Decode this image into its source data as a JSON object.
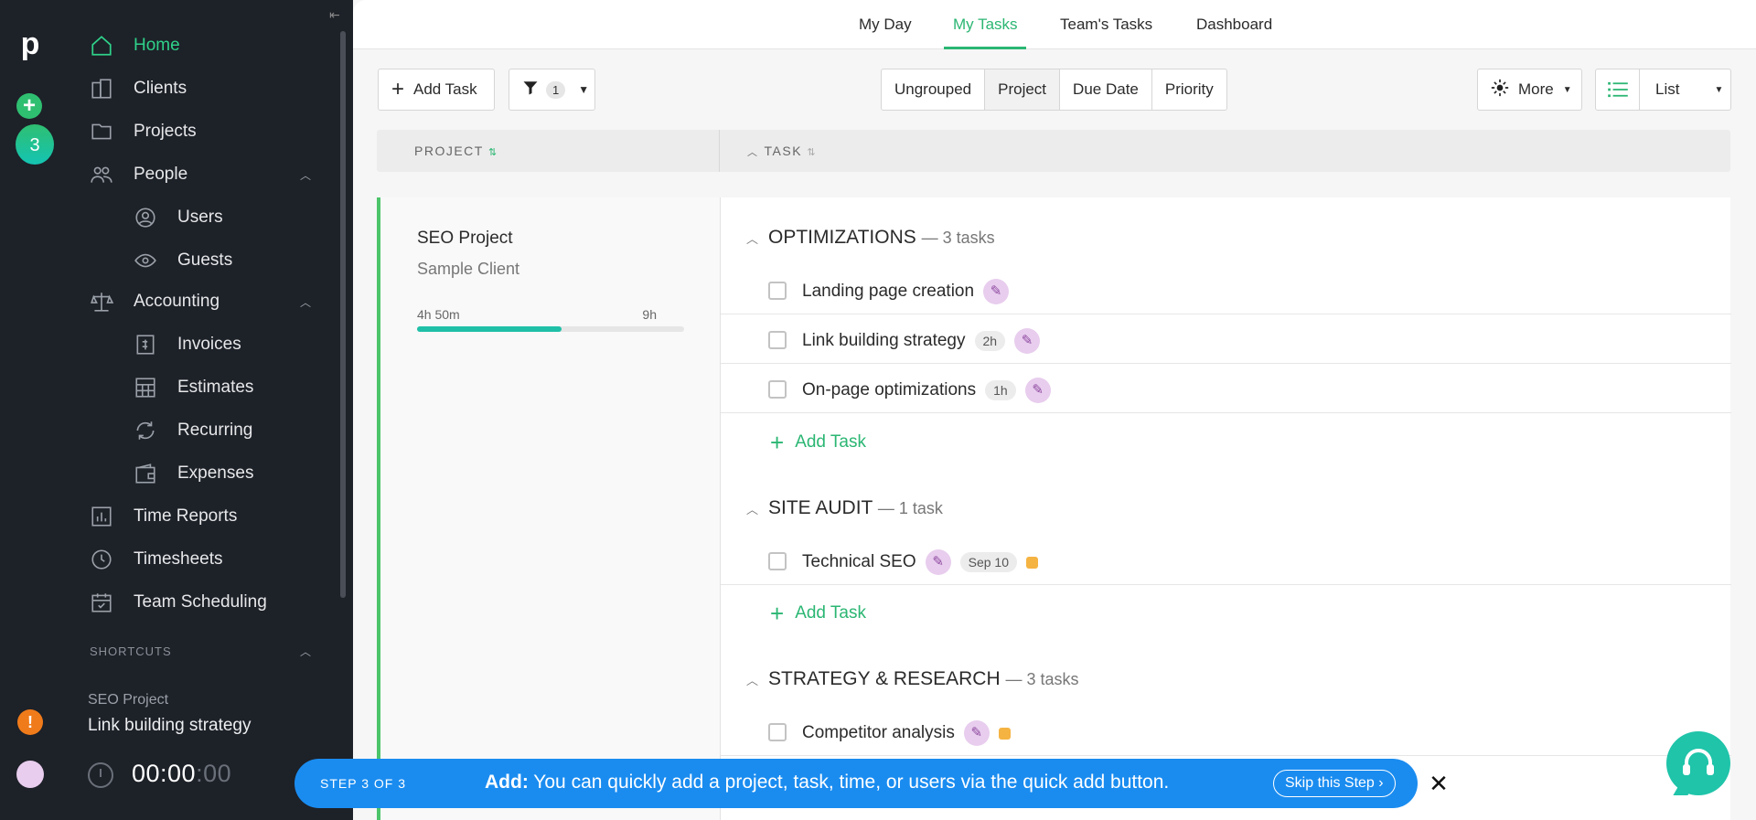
{
  "sidebar": {
    "items": [
      {
        "label": "Home",
        "icon": "home-icon",
        "active": true
      },
      {
        "label": "Clients",
        "icon": "clients-icon"
      },
      {
        "label": "Projects",
        "icon": "folder-icon"
      },
      {
        "label": "People",
        "icon": "people-icon"
      },
      {
        "label": "Users",
        "icon": "user-icon"
      },
      {
        "label": "Guests",
        "icon": "eye-icon"
      },
      {
        "label": "Accounting",
        "icon": "scale-icon"
      },
      {
        "label": "Invoices",
        "icon": "invoice-icon"
      },
      {
        "label": "Estimates",
        "icon": "estimates-icon"
      },
      {
        "label": "Recurring",
        "icon": "recurring-icon"
      },
      {
        "label": "Expenses",
        "icon": "wallet-icon"
      },
      {
        "label": "Time Reports",
        "icon": "chart-icon"
      },
      {
        "label": "Timesheets",
        "icon": "clock-icon"
      },
      {
        "label": "Team Scheduling",
        "icon": "calendar-icon"
      }
    ],
    "shortcuts_title": "SHORTCUTS",
    "shortcut": {
      "project": "SEO Project",
      "task": "Link building strategy"
    },
    "timer": {
      "main": "00:00",
      "sep": ":",
      "sec": "00"
    }
  },
  "rail": {
    "logo": "p",
    "badge": "3",
    "alert": "!"
  },
  "topnav": {
    "tabs": [
      "My Day",
      "My Tasks",
      "Team's Tasks",
      "Dashboard"
    ],
    "active": "My Tasks"
  },
  "toolbar": {
    "add_task": "Add Task",
    "filter_count": "1",
    "group_options": [
      "Ungrouped",
      "Project",
      "Due Date",
      "Priority"
    ],
    "group_selected": "Project",
    "more": "More",
    "view": "List"
  },
  "columns": {
    "project": "PROJECT",
    "task": "TASK"
  },
  "project": {
    "name": "SEO Project",
    "client": "Sample Client",
    "time_spent": "4h 50m",
    "time_budget": "9h",
    "progress": 0.54
  },
  "groups": [
    {
      "title": "OPTIMIZATIONS",
      "count": "— 3 tasks",
      "tasks": [
        {
          "name": "Landing page creation",
          "estimate": "",
          "due": "",
          "priority": false
        },
        {
          "name": "Link building strategy",
          "estimate": "2h",
          "due": "",
          "priority": false
        },
        {
          "name": "On-page optimizations",
          "estimate": "1h",
          "due": "",
          "priority": false
        }
      ]
    },
    {
      "title": "SITE AUDIT",
      "count": "— 1 task",
      "tasks": [
        {
          "name": "Technical SEO",
          "estimate": "",
          "due": "Sep 10",
          "priority": true
        }
      ]
    },
    {
      "title": "STRATEGY & RESEARCH",
      "count": "— 3 tasks",
      "tasks": [
        {
          "name": "Competitor analysis",
          "estimate": "",
          "due": "",
          "priority": true
        }
      ]
    }
  ],
  "add_task_label": "Add Task",
  "tour": {
    "step": "STEP 3 OF 3",
    "title": "Add:",
    "message": "You can quickly add a project, task, time, or users via the quick add button.",
    "skip": "Skip this Step"
  },
  "colors": {
    "accent": "#2bb673",
    "banner": "#1a8cf0",
    "progress": "#1fc0a7",
    "priority": "#f5b342"
  }
}
